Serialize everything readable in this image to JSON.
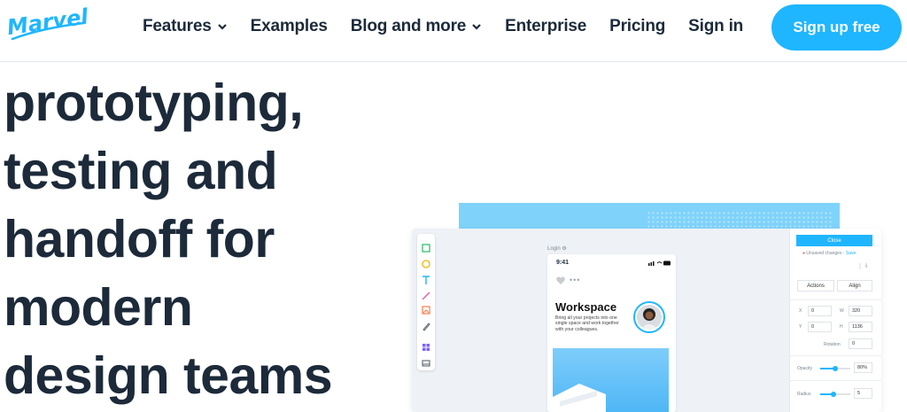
{
  "header": {
    "logo_text": "Marvel",
    "nav": [
      {
        "label": "Features",
        "has_dropdown": true
      },
      {
        "label": "Examples",
        "has_dropdown": false
      },
      {
        "label": "Blog and more",
        "has_dropdown": true
      },
      {
        "label": "Enterprise",
        "has_dropdown": false
      },
      {
        "label": "Pricing",
        "has_dropdown": false
      },
      {
        "label": "Sign in",
        "has_dropdown": false
      }
    ],
    "cta_label": "Sign up free"
  },
  "hero": {
    "lines": [
      "prototyping,",
      "testing and",
      "handoff for",
      "modern",
      "design teams"
    ]
  },
  "mockup": {
    "screen_label": "Login",
    "phone": {
      "time": "9:41",
      "title": "Workspace",
      "description": "Bring all your projects into one single space and work together with your colleagues."
    },
    "properties": {
      "close_label": "Close",
      "unsaved_text": "Unsaved changes",
      "save_link": "Save",
      "actions_label": "Actions",
      "align_label": "Align",
      "x_label": "X",
      "x_value": "0",
      "w_label": "W",
      "w_value": "320",
      "y_label": "Y",
      "y_value": "0",
      "h_label": "H",
      "h_value": "1136",
      "rotation_label": "Rotation",
      "rotation_value": "0",
      "opacity_label": "Opacity",
      "opacity_value": "80%",
      "radius_label": "Radius",
      "radius_value": "5"
    }
  },
  "colors": {
    "brand_blue": "#1fb6ff",
    "text_dark": "#1c2a3a"
  }
}
